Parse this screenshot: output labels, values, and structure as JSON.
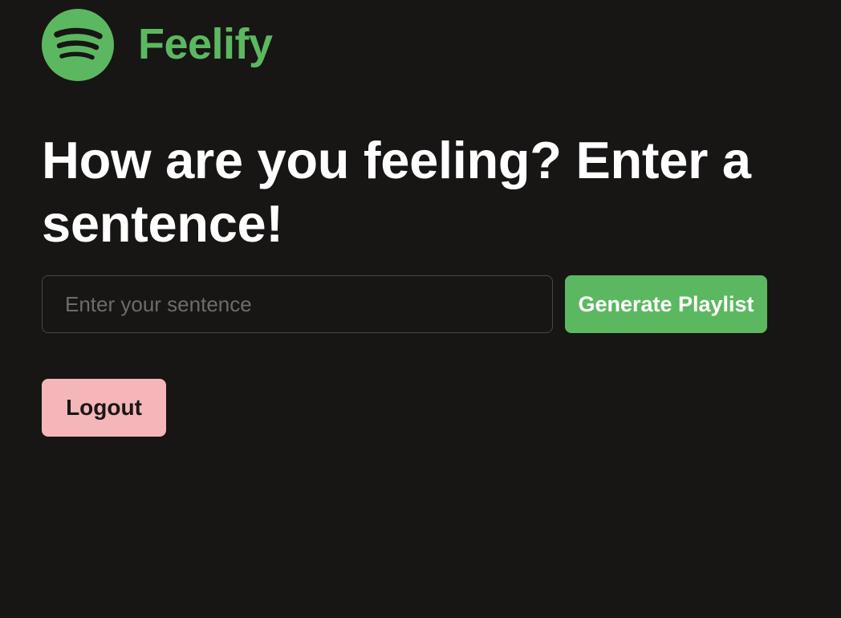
{
  "brand": {
    "name": "Feelify",
    "logo_icon": "spotify-logo-icon",
    "color": "#5cb860"
  },
  "main": {
    "headline": "How are you feeling? Enter a sentence!",
    "sentence_input": {
      "value": "",
      "placeholder": "Enter your sentence"
    },
    "generate_button": {
      "label": "Generate Playlist",
      "color": "#5cb860"
    },
    "logout_button": {
      "label": "Logout",
      "color": "#f4b6b8"
    }
  }
}
